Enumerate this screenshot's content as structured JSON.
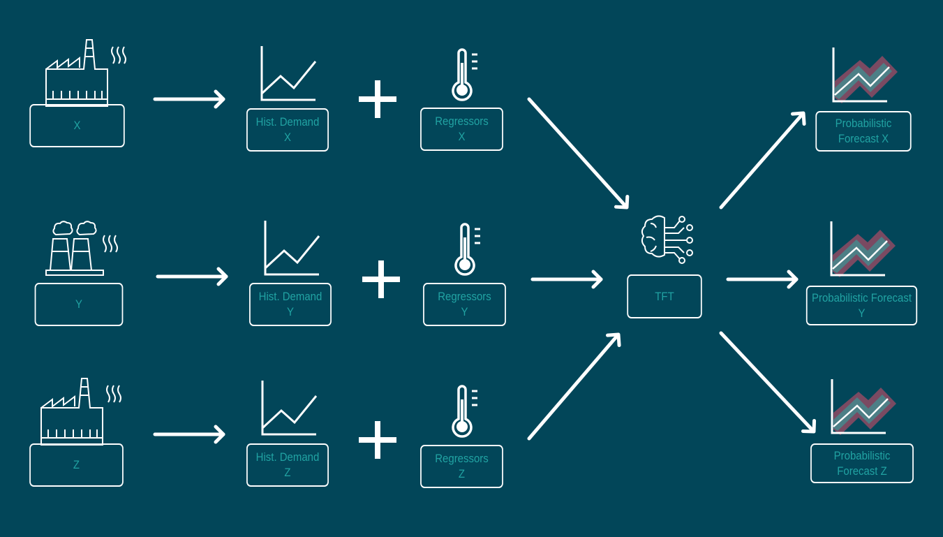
{
  "colors": {
    "background": "#024659",
    "stroke": "#ffffff",
    "label_text": "#21a3a3",
    "band_outer": "#7a4a62",
    "band_inner": "#4d7f86"
  },
  "rows": [
    {
      "source": {
        "label": "X",
        "icon": "factory-icon"
      },
      "history": {
        "line1": "Hist. Demand",
        "line2": "X",
        "icon": "line-chart-icon"
      },
      "regressors": {
        "line1": "Regressors",
        "line2": "X",
        "icon": "thermometer-icon"
      },
      "plus": "+",
      "forecast": {
        "line1": "Probabilistic",
        "line2": "Forecast X",
        "icon": "probabilistic-chart-icon"
      }
    },
    {
      "source": {
        "label": "Y",
        "icon": "power-plant-icon"
      },
      "history": {
        "line1": "Hist. Demand",
        "line2": "Y",
        "icon": "line-chart-icon"
      },
      "regressors": {
        "line1": "Regressors",
        "line2": "Y",
        "icon": "thermometer-icon"
      },
      "plus": "+",
      "forecast": {
        "line1": "Probabilistic Forecast",
        "line2": "Y",
        "icon": "probabilistic-chart-icon"
      }
    },
    {
      "source": {
        "label": "Z",
        "icon": "factory-icon"
      },
      "history": {
        "line1": "Hist. Demand",
        "line2": "Z",
        "icon": "line-chart-icon"
      },
      "regressors": {
        "line1": "Regressors",
        "line2": "Z",
        "icon": "thermometer-icon"
      },
      "plus": "+",
      "forecast": {
        "line1": "Probabilistic",
        "line2": "Forecast Z",
        "icon": "probabilistic-chart-icon"
      }
    }
  ],
  "model": {
    "label": "TFT",
    "icon": "brain-circuit-icon"
  }
}
